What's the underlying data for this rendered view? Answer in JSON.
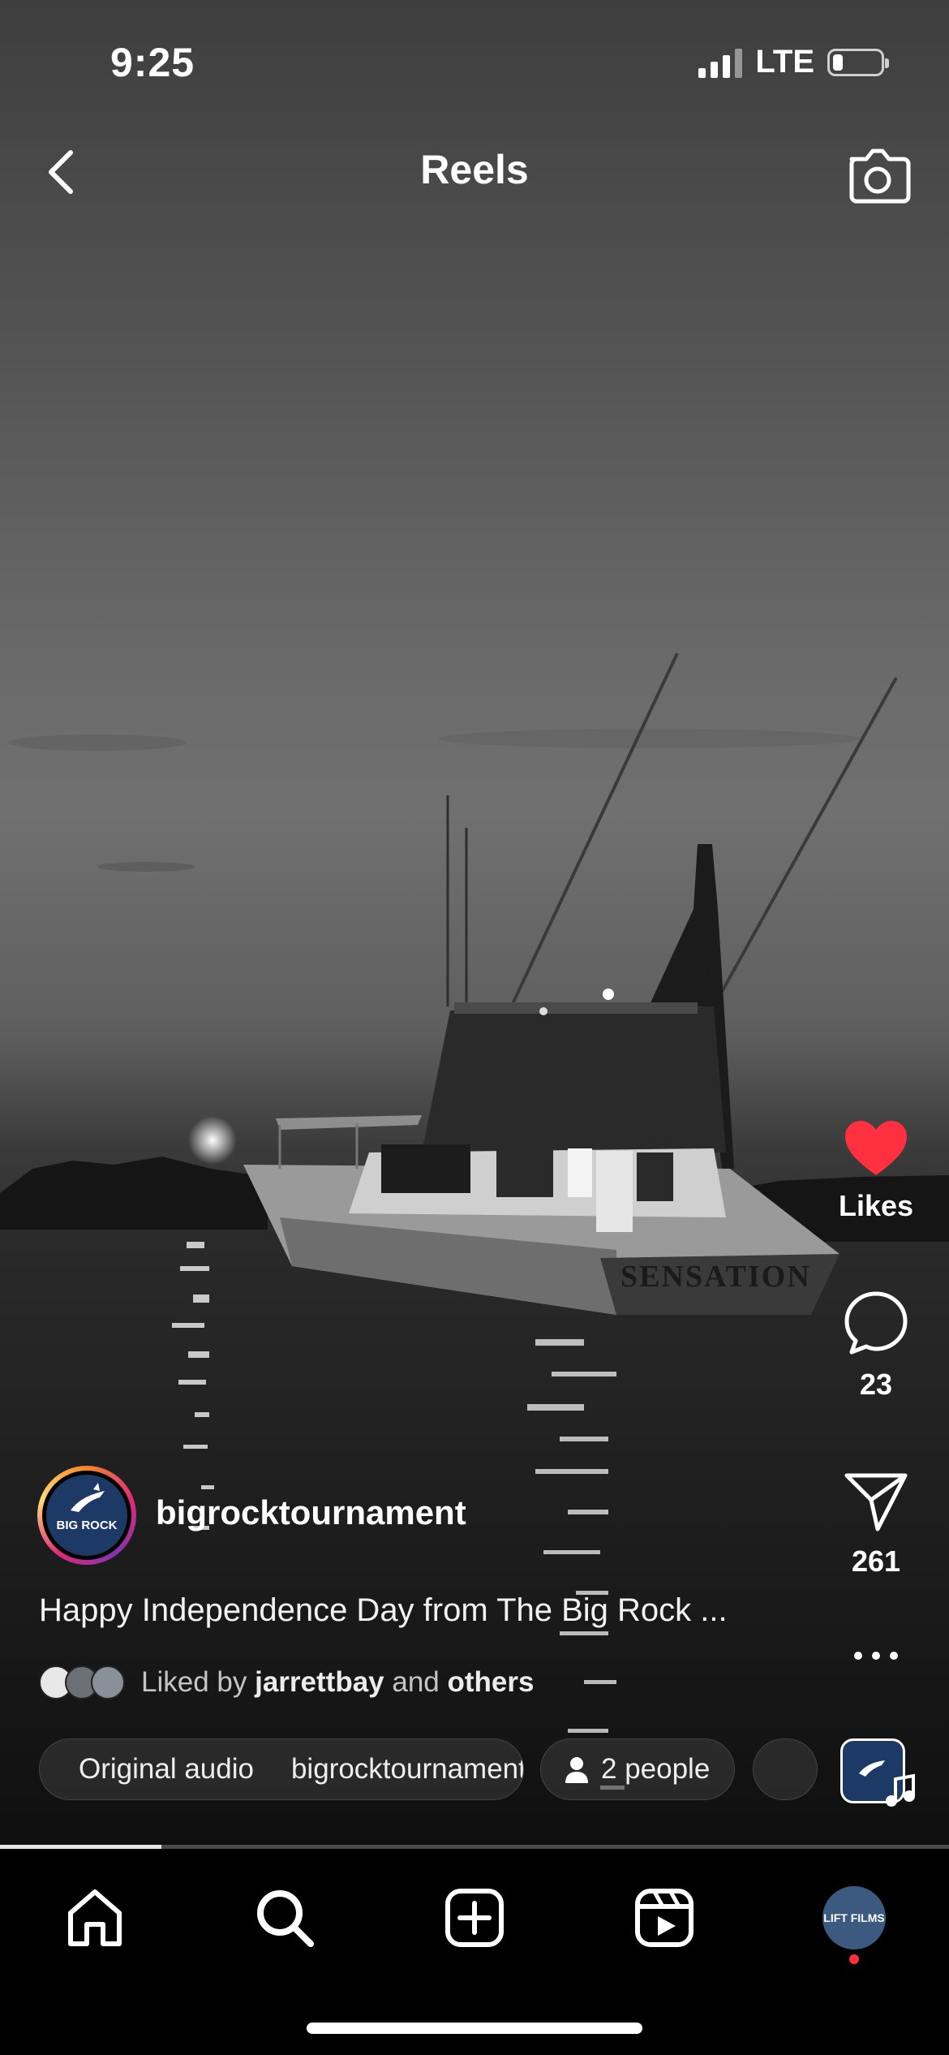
{
  "status_bar": {
    "time": "9:25",
    "network": "LTE"
  },
  "header": {
    "title": "Reels",
    "back_icon": "chevron-left-icon",
    "camera_icon": "camera-icon"
  },
  "actions": {
    "likes_label": "Likes",
    "comments_count": "23",
    "shares_count": "261",
    "more_icon": "more-horizontal-icon",
    "like_color": "#ff3040"
  },
  "post": {
    "username": "bigrocktournament",
    "avatar_text": "BIG ROCK",
    "caption": "Happy Independence Day from The Big Rock ...",
    "liked_by_prefix": "Liked by",
    "liked_by_user": "jarrettbay",
    "liked_by_mid": "and",
    "liked_by_suffix": "others",
    "audio_label": "Original audio",
    "audio_owner": "bigrocktournament",
    "people_label": "2 people",
    "boat_name": "SENSATION"
  },
  "progress": {
    "fraction": 0.17
  },
  "bottom_nav": {
    "items": [
      "home-icon",
      "search-icon",
      "create-icon",
      "reels-icon",
      "profile-avatar"
    ],
    "profile_text": "LIFT FILMS"
  }
}
